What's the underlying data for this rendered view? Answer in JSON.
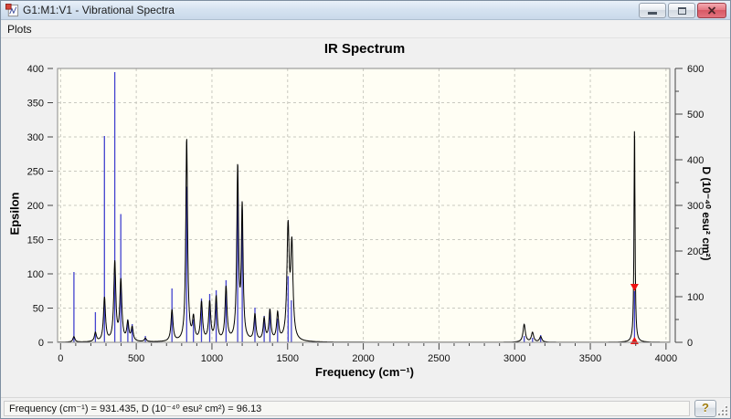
{
  "window": {
    "title": "G1:M1:V1 - Vibrational Spectra"
  },
  "menu": {
    "items": [
      {
        "label": "Plots"
      }
    ]
  },
  "status_bar": {
    "text": "Frequency (cm⁻¹) = 931.435, D (10⁻⁴⁰ esu² cm²) = 96.13",
    "frequency": 931.435,
    "d_value": 96.13,
    "help_label": "?"
  },
  "chart_data": {
    "type": "line",
    "title": "IR Spectrum",
    "xlabel": "Frequency (cm⁻¹)",
    "ylabel_left": "Epsilon",
    "ylabel_right": "D (10⁻⁴⁰ esu² cm²)",
    "xlim": [
      -20,
      4025
    ],
    "ylim_left": [
      0,
      400
    ],
    "ylim_right": [
      0,
      600
    ],
    "x_tick_labels": [
      "0",
      "500",
      "1000",
      "1500",
      "2000",
      "2500",
      "3000",
      "3500",
      "4000"
    ],
    "x_minor_step": 100,
    "left_tick_labels": [
      "0",
      "50",
      "100",
      "150",
      "200",
      "250",
      "300",
      "350",
      "400"
    ],
    "right_tick_labels": [
      "0",
      "100",
      "200",
      "300",
      "400",
      "500",
      "600"
    ],
    "right_minor_step": 50,
    "grid": "dashed",
    "legend": "none",
    "colors": {
      "stick": "#4343cf",
      "curve": "#000000",
      "marker": "#ee1111",
      "grid": "#c9c9c0",
      "plot_bg": "#fffef4",
      "axis": "#444444"
    },
    "sticks_axis": "right",
    "sticks": [
      [
        88,
        154
      ],
      [
        230,
        66
      ],
      [
        290,
        452
      ],
      [
        358,
        592
      ],
      [
        398,
        281
      ],
      [
        444,
        50
      ],
      [
        473,
        40
      ],
      [
        560,
        14
      ],
      [
        736,
        118
      ],
      [
        833,
        341
      ],
      [
        878,
        50
      ],
      [
        931,
        96
      ],
      [
        985,
        106
      ],
      [
        1028,
        114
      ],
      [
        1093,
        136
      ],
      [
        1170,
        330
      ],
      [
        1200,
        290
      ],
      [
        1284,
        76
      ],
      [
        1345,
        58
      ],
      [
        1383,
        72
      ],
      [
        1434,
        52
      ],
      [
        1503,
        145
      ],
      [
        1525,
        92
      ],
      [
        3063,
        14
      ],
      [
        3118,
        10
      ],
      [
        3172,
        16
      ],
      [
        3792,
        112
      ]
    ],
    "curve_axis": "left",
    "curve_peaks": [
      [
        88,
        8,
        8
      ],
      [
        230,
        13,
        8
      ],
      [
        290,
        64,
        8
      ],
      [
        358,
        115,
        8
      ],
      [
        398,
        88,
        8
      ],
      [
        444,
        27,
        8
      ],
      [
        473,
        20,
        8
      ],
      [
        560,
        5,
        8
      ],
      [
        736,
        46,
        8
      ],
      [
        833,
        296,
        7
      ],
      [
        878,
        32,
        8
      ],
      [
        931,
        56,
        8
      ],
      [
        985,
        56,
        8
      ],
      [
        1028,
        63,
        8
      ],
      [
        1093,
        78,
        8
      ],
      [
        1170,
        250,
        7
      ],
      [
        1200,
        192,
        7
      ],
      [
        1284,
        38,
        8
      ],
      [
        1345,
        32,
        8
      ],
      [
        1383,
        44,
        8
      ],
      [
        1434,
        40,
        8
      ],
      [
        1503,
        162,
        9
      ],
      [
        1528,
        135,
        9
      ],
      [
        3063,
        26,
        9
      ],
      [
        3118,
        14,
        9
      ],
      [
        3172,
        8,
        9
      ],
      [
        3792,
        313,
        4
      ]
    ],
    "selected_mode_marker": {
      "frequency": 3792,
      "d": 112
    }
  }
}
